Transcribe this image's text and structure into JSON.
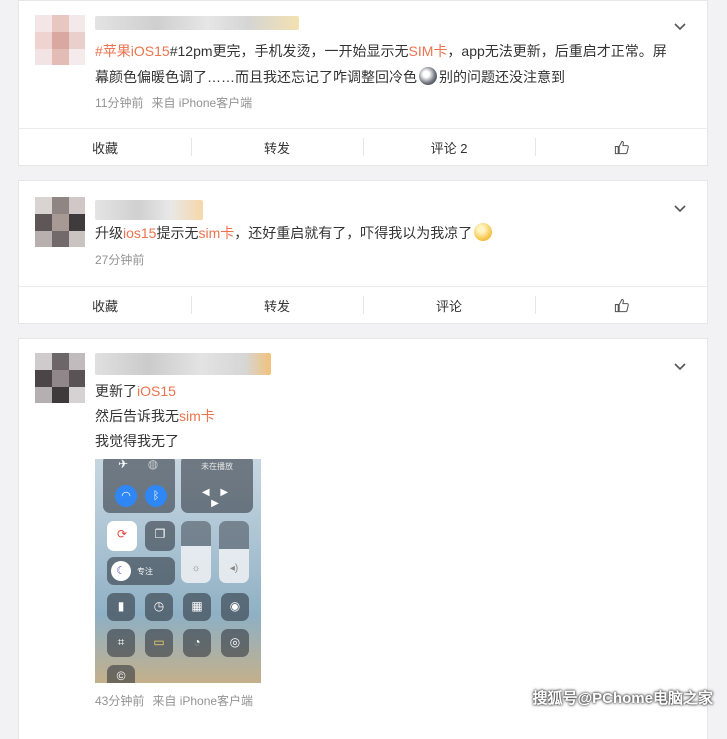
{
  "posts": [
    {
      "text_line1_parts": [
        "#苹果",
        "iOS15",
        "#12pm更完，手机发烫，一开始显示无",
        "SIM卡",
        "，app无法更新，后重启才正常。屏"
      ],
      "text_line2_parts": [
        "幕颜色偏暖色调了……而且我还忘记了咋调整回冷色",
        "别的问题还没注意到"
      ],
      "time": "11分钟前",
      "source": "来自 iPhone客户端",
      "actions": {
        "collect": "收藏",
        "forward": "转发",
        "comment": "评论 2",
        "like_icon": "thumbs-up-icon"
      }
    },
    {
      "text_parts": [
        "升级",
        "ios15",
        "提示无",
        "sim卡",
        "，还好重启就有了，吓得我以为我凉了"
      ],
      "time": "27分钟前",
      "actions": {
        "collect": "收藏",
        "forward": "转发",
        "comment": "评论",
        "like_icon": "thumbs-up-icon"
      }
    },
    {
      "line1_parts": [
        "更新了",
        "iOS15"
      ],
      "line2_parts": [
        "然后告诉我无",
        "sim卡"
      ],
      "line3": "我觉得我无了",
      "image": {
        "playback_label": "未在播放",
        "focus_label": "专注"
      },
      "time": "43分钟前",
      "source": "来自 iPhone客户端"
    }
  ],
  "watermark": "搜狐号@PChome电脑之家",
  "colors": {
    "accent": "#eb7350",
    "meta": "#939393",
    "background": "#f2f2f5"
  }
}
